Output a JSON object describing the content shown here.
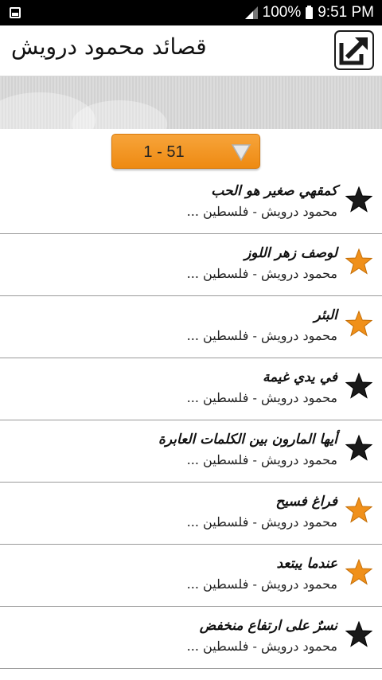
{
  "status_bar": {
    "battery": "100%",
    "time": "9:51 PM",
    "icons": [
      "gallery-icon",
      "signal-icon",
      "battery-icon"
    ]
  },
  "header": {
    "title": "قصائد محمود درويش",
    "share_icon": "share-icon"
  },
  "range": {
    "label": "1 - 51",
    "icon": "dropdown-triangle-icon"
  },
  "colors": {
    "accent_orange": "#f29a26",
    "star_orange": "#f0901a",
    "star_black": "#1a1a1a",
    "divider": "#9a9a9a"
  },
  "list": {
    "items": [
      {
        "title": "كمقهي صغير هو الحب",
        "subtitle": "محمود درويش - فلسطين ...",
        "starred": false
      },
      {
        "title": "لوصف زهر اللوز",
        "subtitle": "محمود درويش - فلسطين ...",
        "starred": true
      },
      {
        "title": "البئر",
        "subtitle": "محمود درويش - فلسطين ...",
        "starred": true
      },
      {
        "title": "في يدي غيمة",
        "subtitle": "محمود درويش - فلسطين ...",
        "starred": false
      },
      {
        "title": "أيها المارون بين الكلمات العابرة",
        "subtitle": "محمود درويش - فلسطين ...",
        "starred": false
      },
      {
        "title": "فراغ فسيح",
        "subtitle": "محمود درويش - فلسطين ...",
        "starred": true
      },
      {
        "title": "عندما يبتعد",
        "subtitle": "محمود درويش - فلسطين ...",
        "starred": true
      },
      {
        "title": "نسرٌ على ارتفاع منخفض",
        "subtitle": "محمود درويش - فلسطين ...",
        "starred": false
      }
    ]
  }
}
